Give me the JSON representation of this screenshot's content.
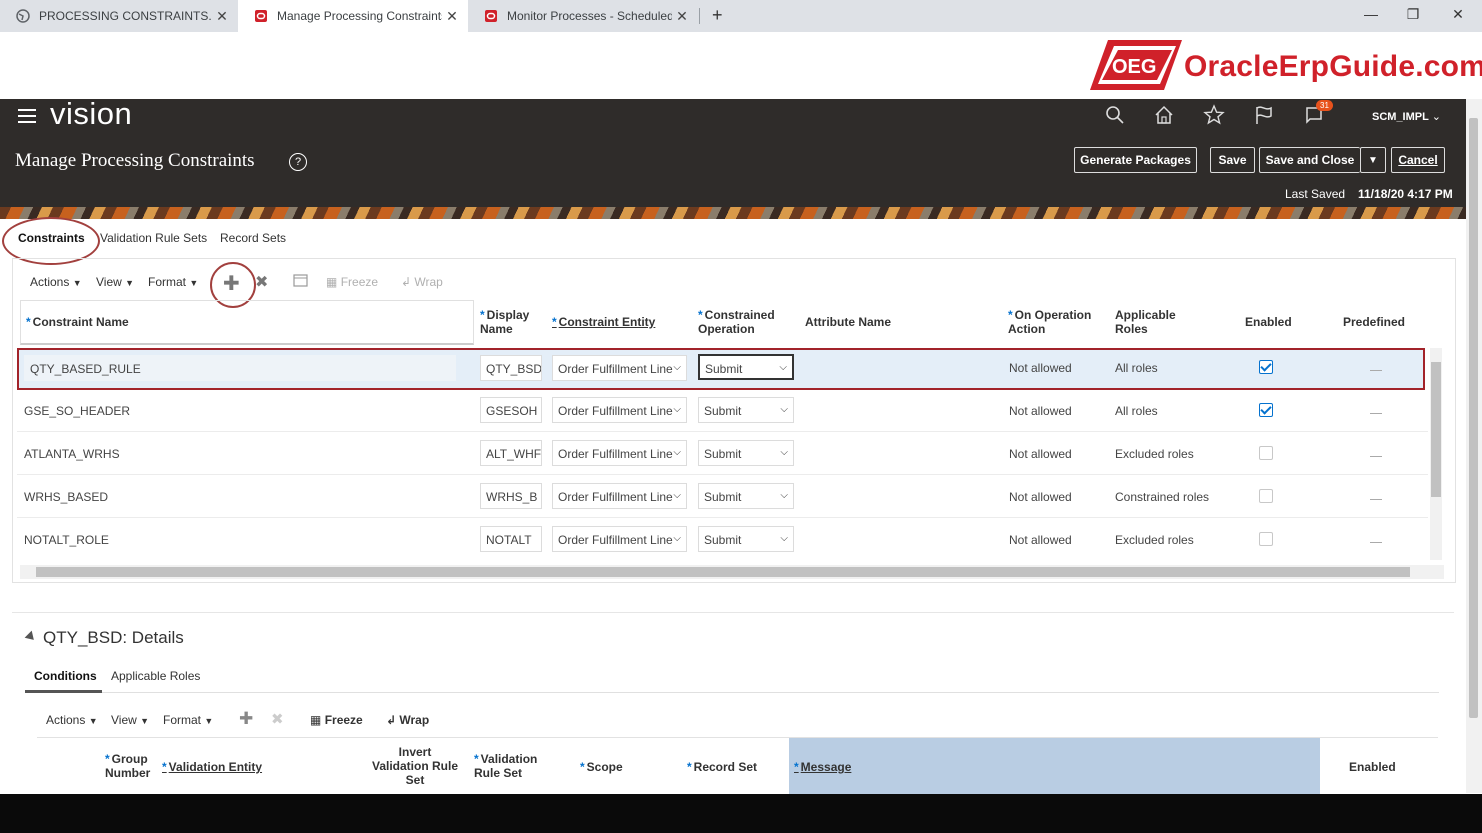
{
  "browser": {
    "tabs": [
      {
        "title": "PROCESSING CONSTRAINTS.pdf"
      },
      {
        "title": "Manage Processing Constraints -"
      },
      {
        "title": "Monitor Processes - Scheduled P"
      }
    ],
    "new_tab": "+"
  },
  "watermark": {
    "logo_box": "OEG",
    "logo_text": "OracleErpGuide.com"
  },
  "header": {
    "app_name": "vision",
    "page_title": "Manage Processing Constraints",
    "notification_count": "31",
    "user": "SCM_IMPL",
    "buttons": {
      "generate": "Generate Packages",
      "save": "Save",
      "save_close": "Save and Close",
      "cancel": "Cancel"
    },
    "last_saved_label": "Last Saved",
    "last_saved_value": "11/18/20 4:17 PM"
  },
  "page_tabs": [
    "Constraints",
    "Validation Rule Sets",
    "Record Sets"
  ],
  "toolbar": {
    "actions": "Actions",
    "view": "View",
    "format": "Format",
    "freeze": "Freeze",
    "wrap": "Wrap"
  },
  "table": {
    "columns": {
      "constraint_name": "Constraint Name",
      "display_name_1": "Display",
      "display_name_2": "Name",
      "constraint_entity": "Constraint Entity",
      "constrained_op_1": "Constrained",
      "constrained_op_2": "Operation",
      "attribute_name": "Attribute Name",
      "on_op_action_1": "On Operation",
      "on_op_action_2": "Action",
      "applicable_roles_1": "Applicable",
      "applicable_roles_2": "Roles",
      "enabled": "Enabled",
      "predefined": "Predefined"
    },
    "rows": [
      {
        "name": "QTY_BASED_RULE",
        "display": "QTY_BSD",
        "entity": "Order Fulfillment Line",
        "operation": "Submit",
        "action": "Not allowed",
        "roles": "All roles",
        "enabled": true
      },
      {
        "name": "GSE_SO_HEADER",
        "display": "GSESOH",
        "entity": "Order Fulfillment Line",
        "operation": "Submit",
        "action": "Not allowed",
        "roles": "All roles",
        "enabled": true
      },
      {
        "name": "ATLANTA_WRHS",
        "display": "ALT_WHF",
        "entity": "Order Fulfillment Line",
        "operation": "Submit",
        "action": "Not allowed",
        "roles": "Excluded roles",
        "enabled": false
      },
      {
        "name": "WRHS_BASED",
        "display": "WRHS_B",
        "entity": "Order Fulfillment Line",
        "operation": "Submit",
        "action": "Not allowed",
        "roles": "Constrained roles",
        "enabled": false
      },
      {
        "name": "NOTALT_ROLE",
        "display": "NOTALT",
        "entity": "Order Fulfillment Line",
        "operation": "Submit",
        "action": "Not allowed",
        "roles": "Excluded roles",
        "enabled": false
      }
    ]
  },
  "details": {
    "title": "QTY_BSD: Details",
    "tabs": [
      "Conditions",
      "Applicable Roles"
    ],
    "toolbar": {
      "actions": "Actions",
      "view": "View",
      "format": "Format",
      "freeze": "Freeze",
      "wrap": "Wrap"
    },
    "columns": {
      "group_1": "Group",
      "group_2": "Number",
      "validation_entity": "Validation Entity",
      "invert_1": "Invert",
      "invert_2": "Validation Rule",
      "invert_3": "Set",
      "val_rule_set_1": "Validation",
      "val_rule_set_2": "Rule Set",
      "scope": "Scope",
      "record_set": "Record Set",
      "message": "Message",
      "enabled": "Enabled"
    }
  },
  "colors": {
    "header_bg": "#2f2c2a",
    "accent_red": "#a2403e",
    "link_blue": "#0572ce",
    "message_col": "#b9cde3"
  }
}
